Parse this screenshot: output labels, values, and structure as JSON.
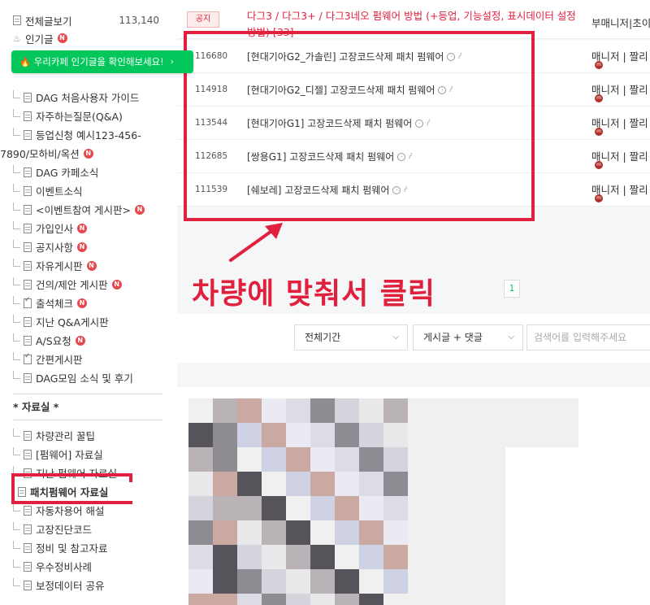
{
  "sidebar": {
    "all_posts_label": "전체글보기",
    "all_posts_count": "113,140",
    "popular_label": "인기글",
    "popular_banner": "우리카페 인기글을 확인해보세요!",
    "menu_items": [
      {
        "label": "DAG 처음사용자 가이드",
        "new": false
      },
      {
        "label": "자주하는질문(Q&A)",
        "new": false
      },
      {
        "label": "등업신청 예시123-456-",
        "new": false
      },
      {
        "label": "7890/모하비/옥션",
        "new": true
      },
      {
        "label": "DAG 카페소식",
        "new": false
      },
      {
        "label": "이벤트소식",
        "new": false
      },
      {
        "label": "<이벤트참여 게시판>",
        "new": true
      },
      {
        "label": "가입인사",
        "new": true
      },
      {
        "label": "공지사항",
        "new": true
      },
      {
        "label": "자유게시판",
        "new": true
      },
      {
        "label": "건의/제안 게시판",
        "new": true
      },
      {
        "label": "출석체크",
        "new": true
      },
      {
        "label": "지난 Q&A게시판",
        "new": false
      },
      {
        "label": "A/S요청",
        "new": true
      },
      {
        "label": "간편게시판",
        "new": false
      },
      {
        "label": "DAG모임 소식 및 후기",
        "new": false
      }
    ],
    "section_title": "* 자료실 *",
    "data_items": [
      {
        "label": "차량관리 꿀팁"
      },
      {
        "label": "[펌웨어] 자료실"
      },
      {
        "label": "지난 펌웨어 자료실"
      },
      {
        "label": "패치펌웨어 자료실"
      },
      {
        "label": "자동차용어 해설"
      },
      {
        "label": "고장진단코드"
      },
      {
        "label": "정비 및 참고자료"
      },
      {
        "label": "우수정비사례"
      },
      {
        "label": "보정데이터 공유"
      }
    ]
  },
  "main": {
    "notice_tag": "공지",
    "notice_title": "다그3 / 다그3+ / 다그3네오 펌웨어 방법 (+등업, 기능설정, 표시데이터 설정 방법) [33]",
    "notice_author": "부매니저|초이",
    "posts": [
      {
        "num": "116680",
        "title": "[현대기아G2_가솔린] 고장코드삭제 패치 펌웨어",
        "author": "매니저 | 짤리"
      },
      {
        "num": "114918",
        "title": "[현대기아G2_디젤] 고장코드삭제 패치 펌웨어",
        "author": "매니저 | 짤리"
      },
      {
        "num": "113544",
        "title": "[현대기아G1] 고장코드삭제 패치 펌웨어",
        "author": "매니저 | 짤리"
      },
      {
        "num": "112685",
        "title": "[쌍용G1] 고장코드삭제 패치 펌웨어",
        "author": "매니저 | 짤리"
      },
      {
        "num": "111539",
        "title": "[쉐보레] 고장코드삭제 패치 펌웨어",
        "author": "매니저 | 짤리"
      }
    ],
    "annotation": "차량에 맞춰서 클릭",
    "page_number": "1",
    "filter_period": "전체기간",
    "filter_scope": "게시글 + 댓글",
    "search_placeholder": "검색어를 입력해주세요"
  },
  "colors": {
    "highlight_red": "#e0203d",
    "naver_green": "#03c75a",
    "new_badge": "#e5484d"
  },
  "icons": {
    "doc": "document-icon",
    "new": "new-badge-icon",
    "comment": "comment-icon",
    "attach": "paperclip-icon",
    "level": "member-level-icon",
    "chevron": "chevron-down-icon",
    "arrow": "arrow-up-right-icon"
  }
}
